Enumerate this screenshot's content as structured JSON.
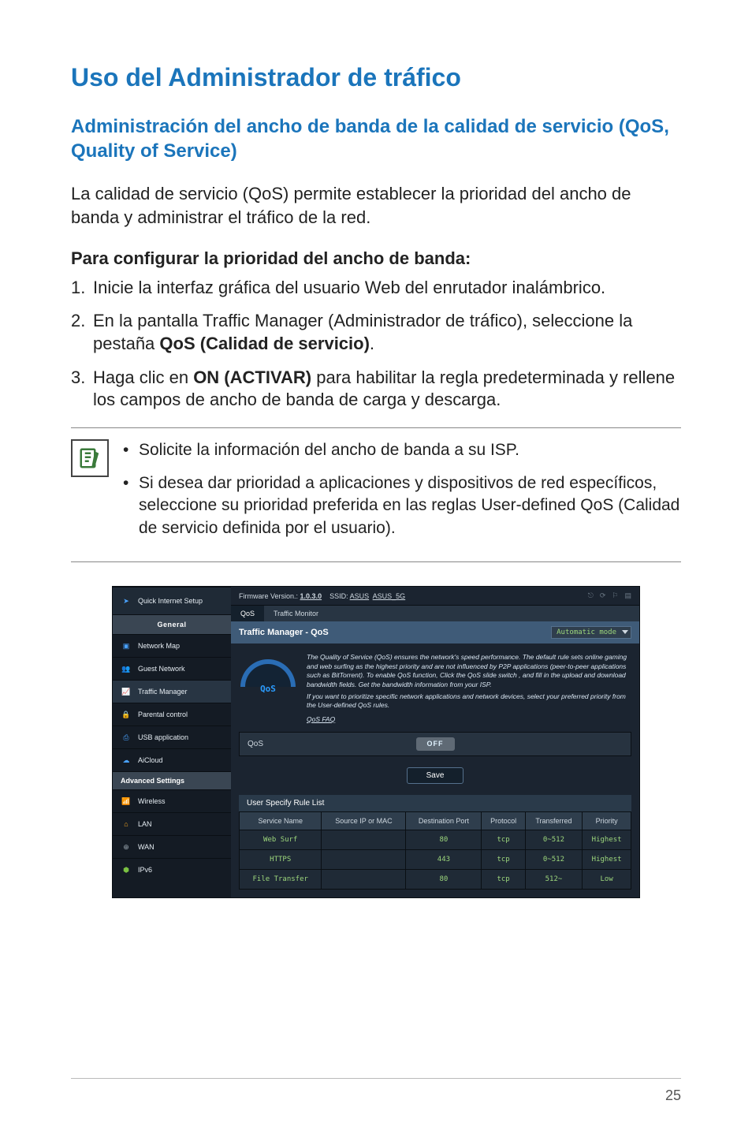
{
  "title": "Uso del Administrador de tráfico",
  "subtitle": "Administración del ancho de banda de la calidad de servicio (QoS, Quality of Service)",
  "intro_para": "La calidad de servicio (QoS) permite establecer la prioridad del ancho de banda y administrar el tráfico de la red.",
  "steps_heading": "Para configurar la prioridad del ancho de banda:",
  "steps": [
    {
      "num": "1.",
      "text": "Inicie la interfaz gráfica del usuario Web del enrutador inalámbrico."
    },
    {
      "num": "2.",
      "prefix": "En la pantalla Traffic Manager (Administrador de tráfico), seleccione la pestaña ",
      "bold": "QoS (Calidad de servicio)",
      "suffix": "."
    },
    {
      "num": "3.",
      "prefix": "Haga clic en ",
      "bold": "ON (ACTIVAR)",
      "suffix": " para habilitar la regla predeterminada y rellene los campos de ancho de banda de carga y descarga."
    }
  ],
  "notes": [
    "Solicite la información del ancho de banda a su ISP.",
    "Si desea dar prioridad a aplicaciones y dispositivos de red específicos, seleccione su prioridad preferida en las reglas User-defined QoS (Calidad de servicio definida por el usuario)."
  ],
  "screenshot": {
    "firmware_label": "Firmware Version.:",
    "firmware_ver": "1.0.3.0",
    "ssid_label": "SSID:",
    "ssid1": "ASUS",
    "ssid2": "ASUS_5G",
    "side": {
      "quick": "Quick Internet Setup",
      "general": "General",
      "items": [
        "Network Map",
        "Guest Network",
        "Traffic Manager",
        "Parental control",
        "USB application",
        "AiCloud"
      ],
      "advanced": "Advanced Settings",
      "adv_items": [
        "Wireless",
        "LAN",
        "WAN",
        "IPv6"
      ]
    },
    "tabs": {
      "qos": "QoS",
      "monitor": "Traffic Monitor"
    },
    "panel_title": "Traffic Manager - QoS",
    "mode": "Automatic mode",
    "gauge": "QoS",
    "desc_lines": [
      "The Quality of Service (QoS) ensures the network's speed performance. The default rule sets online gaming and web surfing as the highest priority and are not influenced by P2P applications (peer-to-peer applications such as BitTorrent). To enable QoS function, Click the QoS slide switch , and fill in the upload and download bandwidth fields. Get the bandwidth information from your ISP.",
      "If you want to prioritize specific network applications and network devices, select your preferred priority from the User-defined QoS rules."
    ],
    "faq_link": "QoS FAQ",
    "qos_label": "QoS",
    "toggle": "OFF",
    "save_btn": "Save",
    "rule_list_title": "User Specify Rule List",
    "columns": [
      "Service Name",
      "Source IP or MAC",
      "Destination Port",
      "Protocol",
      "Transferred",
      "Priority"
    ],
    "rows": [
      {
        "service": "Web Surf",
        "src": "",
        "port": "80",
        "proto": "tcp",
        "trans": "0~512",
        "prio": "Highest"
      },
      {
        "service": "HTTPS",
        "src": "",
        "port": "443",
        "proto": "tcp",
        "trans": "0~512",
        "prio": "Highest"
      },
      {
        "service": "File Transfer",
        "src": "",
        "port": "80",
        "proto": "tcp",
        "trans": "512~",
        "prio": "Low"
      }
    ]
  },
  "page_number": "25"
}
